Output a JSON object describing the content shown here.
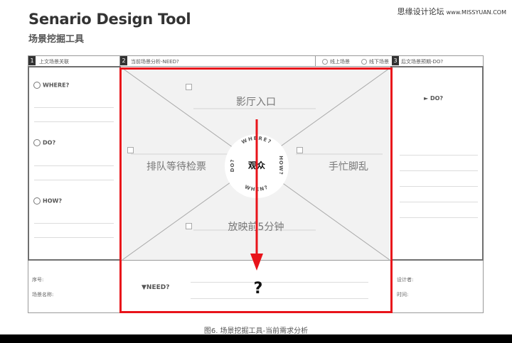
{
  "header": {
    "title": "Senario Design Tool",
    "subtitle": "场景挖掘工具",
    "watermark_cn": "思缘设计论坛",
    "watermark_url": "www.MISSYUAN.COM"
  },
  "sheet": {
    "section1": {
      "number": "1",
      "label": "上文场景关联"
    },
    "section2": {
      "number": "2",
      "label": "当前场景分析-NEED?"
    },
    "section3": {
      "number": "3",
      "label": "后文场景预期-DO?"
    },
    "options": {
      "online": "线上场景",
      "offline": "线下场景"
    },
    "left_questions": {
      "where": "WHERE?",
      "do": "DO?",
      "how": "HOW?"
    },
    "right_question": "► DO?",
    "center": {
      "hub": "观众",
      "ring": {
        "where": "WHERE?",
        "how": "HOW?",
        "when": "WHEN?",
        "do": "DO?"
      },
      "top": "影厅入口",
      "left": "排队等待检票",
      "right": "手忙脚乱",
      "bottom": "放映前5分钟"
    },
    "need": {
      "label": "▼NEED?",
      "answer": "?"
    },
    "footer_left": {
      "serial": "序号:",
      "scene_name": "场景名称:"
    },
    "footer_right": {
      "designer": "设计者:",
      "time": "时间:"
    }
  },
  "caption": "图6. 场景挖掘工具-当前需求分析",
  "colors": {
    "highlight": "#e8141b",
    "panel": "#f2f2f2",
    "hub_bg": "#ffffff"
  }
}
